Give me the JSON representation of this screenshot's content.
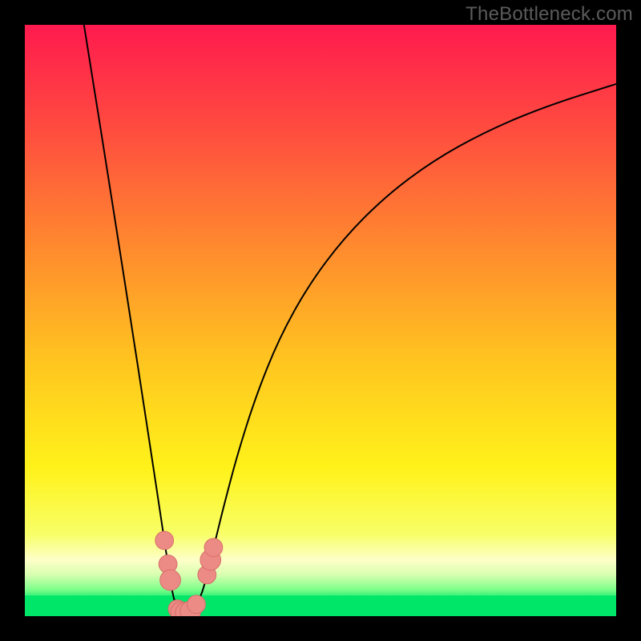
{
  "watermark": "TheBottleneck.com",
  "colors": {
    "frame": "#000000",
    "curve": "#000000",
    "marker_fill": "#ec8a85",
    "marker_stroke": "#d86f6a",
    "green_band": "#00e669"
  },
  "chart_data": {
    "type": "line",
    "title": "",
    "xlabel": "",
    "ylabel": "",
    "xlim": [
      0,
      100
    ],
    "ylim": [
      0,
      100
    ],
    "gradient_stops": [
      {
        "offset": 0,
        "color": "#ff1a4e"
      },
      {
        "offset": 0.18,
        "color": "#ff4d3f"
      },
      {
        "offset": 0.38,
        "color": "#ff8b2e"
      },
      {
        "offset": 0.58,
        "color": "#ffc81f"
      },
      {
        "offset": 0.75,
        "color": "#fff21a"
      },
      {
        "offset": 0.86,
        "color": "#f8ff66"
      },
      {
        "offset": 0.905,
        "color": "#fdffc8"
      },
      {
        "offset": 0.93,
        "color": "#d8ffb0"
      },
      {
        "offset": 0.955,
        "color": "#7dff8a"
      },
      {
        "offset": 0.975,
        "color": "#00e669"
      },
      {
        "offset": 1.0,
        "color": "#00e669"
      }
    ],
    "series": [
      {
        "name": "bottleneck-curve",
        "x": [
          10.0,
          12.0,
          14.0,
          16.0,
          18.0,
          20.0,
          21.5,
          23.0,
          24.0,
          25.0,
          25.8,
          26.6,
          27.3,
          28.0,
          29.0,
          30.0,
          31.0,
          32.5,
          34.0,
          36.0,
          39.0,
          43.0,
          48.0,
          54.0,
          61.0,
          69.0,
          78.0,
          88.0,
          100.0
        ],
        "y": [
          100.0,
          87.5,
          75.0,
          62.2,
          49.5,
          36.5,
          26.7,
          16.8,
          10.1,
          3.5,
          1.2,
          0.6,
          0.6,
          0.8,
          2.0,
          3.9,
          7.8,
          14.0,
          20.0,
          27.5,
          37.0,
          47.0,
          56.0,
          64.0,
          71.0,
          77.0,
          82.0,
          86.2,
          90.0
        ]
      }
    ],
    "markers": [
      {
        "x": 23.6,
        "y": 12.8,
        "r": 1.0
      },
      {
        "x": 24.2,
        "y": 8.8,
        "r": 1.0
      },
      {
        "x": 24.6,
        "y": 6.1,
        "r": 1.2
      },
      {
        "x": 25.8,
        "y": 1.2,
        "r": 1.0
      },
      {
        "x": 26.4,
        "y": 0.7,
        "r": 1.2
      },
      {
        "x": 27.2,
        "y": 0.6,
        "r": 1.2
      },
      {
        "x": 28.0,
        "y": 0.8,
        "r": 1.2
      },
      {
        "x": 29.0,
        "y": 2.0,
        "r": 1.0
      },
      {
        "x": 30.8,
        "y": 7.0,
        "r": 1.0
      },
      {
        "x": 31.4,
        "y": 9.5,
        "r": 1.2
      },
      {
        "x": 31.9,
        "y": 11.6,
        "r": 1.0
      }
    ]
  }
}
